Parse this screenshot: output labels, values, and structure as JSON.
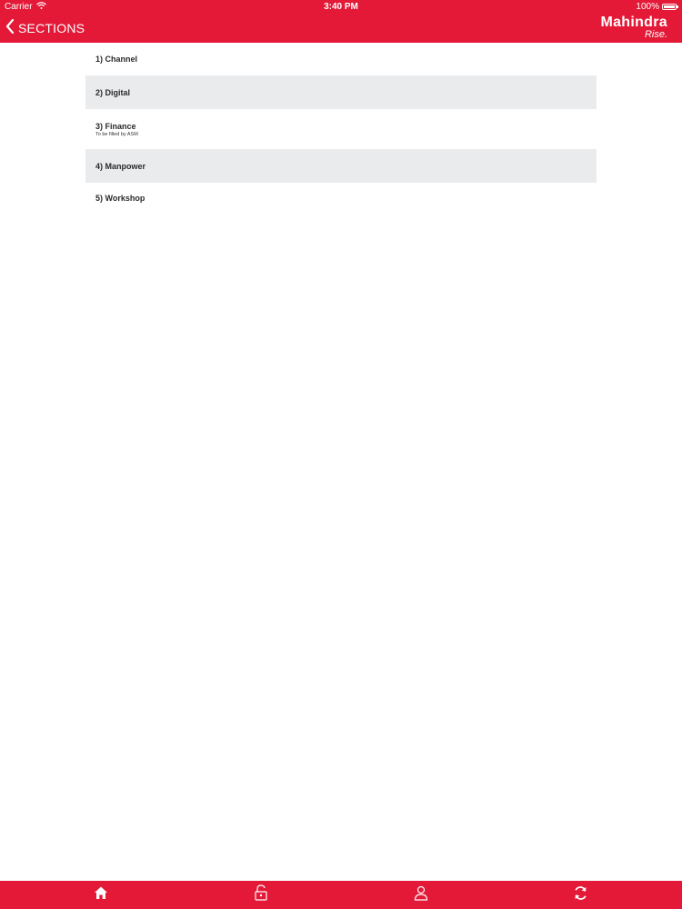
{
  "status_bar": {
    "carrier": "Carrier",
    "time": "3:40 PM",
    "battery": "100%"
  },
  "nav": {
    "back_label": "SECTIONS",
    "logo_brand": "Mahindra",
    "logo_tagline": "Rise."
  },
  "sections": [
    {
      "title": "1) Channel",
      "subtitle": ""
    },
    {
      "title": "2) Digital",
      "subtitle": ""
    },
    {
      "title": "3) Finance",
      "subtitle": "To be filled by ASM"
    },
    {
      "title": "4) Manpower",
      "subtitle": ""
    },
    {
      "title": "5) Workshop",
      "subtitle": ""
    }
  ],
  "tabs": [
    {
      "icon": "home-icon"
    },
    {
      "icon": "unlock-icon"
    },
    {
      "icon": "user-icon"
    },
    {
      "icon": "sync-icon"
    }
  ],
  "colors": {
    "brand": "#e31937",
    "row_shade": "#e9ebed"
  }
}
